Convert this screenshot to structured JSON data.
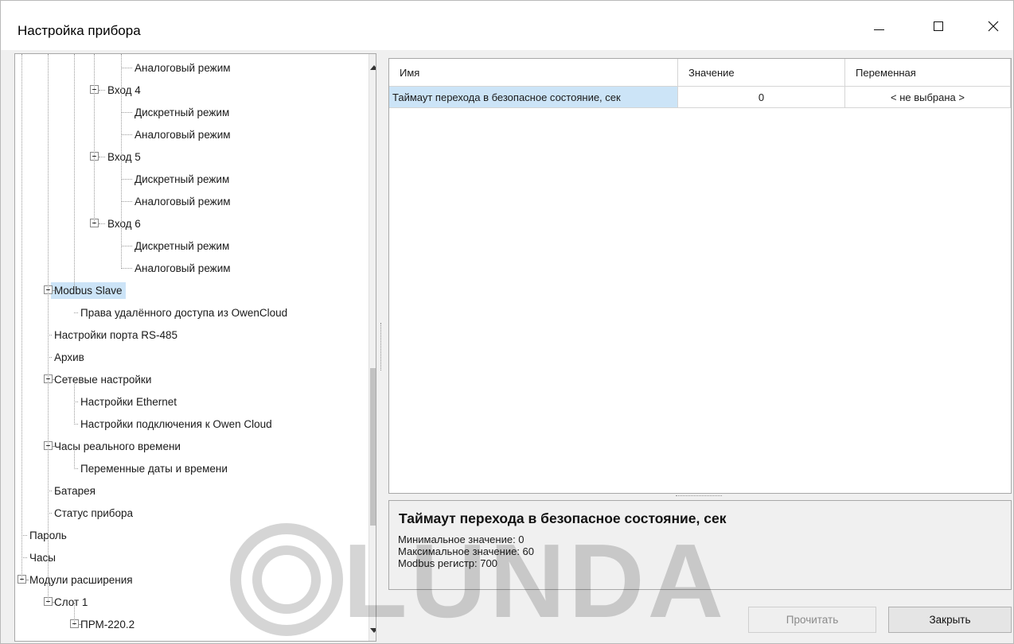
{
  "window": {
    "title": "Настройка прибора"
  },
  "tree": {
    "items": [
      {
        "label": "Аналоговый режим",
        "level": 4,
        "expander": false
      },
      {
        "label": "Вход 4",
        "level": 3,
        "expander": true
      },
      {
        "label": "Дискретный режим",
        "level": 4,
        "expander": false
      },
      {
        "label": "Аналоговый режим",
        "level": 4,
        "expander": false
      },
      {
        "label": "Вход 5",
        "level": 3,
        "expander": true
      },
      {
        "label": "Дискретный режим",
        "level": 4,
        "expander": false
      },
      {
        "label": "Аналоговый режим",
        "level": 4,
        "expander": false
      },
      {
        "label": "Вход 6",
        "level": 3,
        "expander": true
      },
      {
        "label": "Дискретный режим",
        "level": 4,
        "expander": false
      },
      {
        "label": "Аналоговый режим",
        "level": 4,
        "expander": false
      },
      {
        "label": "Modbus Slave",
        "level": 1,
        "expander": true,
        "selected": true
      },
      {
        "label": "Права удалённого доступа из OwenCloud",
        "level": 2,
        "expander": false
      },
      {
        "label": "Настройки порта RS-485",
        "level": 1,
        "expander": false
      },
      {
        "label": "Архив",
        "level": 1,
        "expander": false
      },
      {
        "label": "Сетевые настройки",
        "level": 1,
        "expander": true
      },
      {
        "label": "Настройки Ethernet",
        "level": 2,
        "expander": false
      },
      {
        "label": "Настройки подключения к Owen Cloud",
        "level": 2,
        "expander": false
      },
      {
        "label": "Часы реального времени",
        "level": 1,
        "expander": true
      },
      {
        "label": "Переменные даты и времени",
        "level": 2,
        "expander": false
      },
      {
        "label": "Батарея",
        "level": 1,
        "expander": false
      },
      {
        "label": "Статус прибора",
        "level": 1,
        "expander": false
      },
      {
        "label": "Пароль",
        "level": 0,
        "expander": false
      },
      {
        "label": "Часы",
        "level": 0,
        "expander": false
      },
      {
        "label": "Модули расширения",
        "level": 0,
        "expander": true
      },
      {
        "label": "Слот 1",
        "level": 1,
        "expander": true
      },
      {
        "label": "ПРМ-220.2",
        "level": 2,
        "expander": true
      }
    ]
  },
  "grid": {
    "columns": [
      "Имя",
      "Значение",
      "Переменная"
    ],
    "rows": [
      {
        "name": "Таймаут перехода в безопасное состояние, сек",
        "value": "0",
        "variable": "< не выбрана >"
      }
    ]
  },
  "description": {
    "title": "Таймаут перехода в безопасное состояние, сек",
    "lines": [
      "Минимальное значение: 0",
      "Максимальное значение: 60",
      "Modbus регистр: 700"
    ]
  },
  "buttons": {
    "read": "Прочитать",
    "close": "Закрыть"
  },
  "watermark": {
    "text": "LUNDA"
  }
}
